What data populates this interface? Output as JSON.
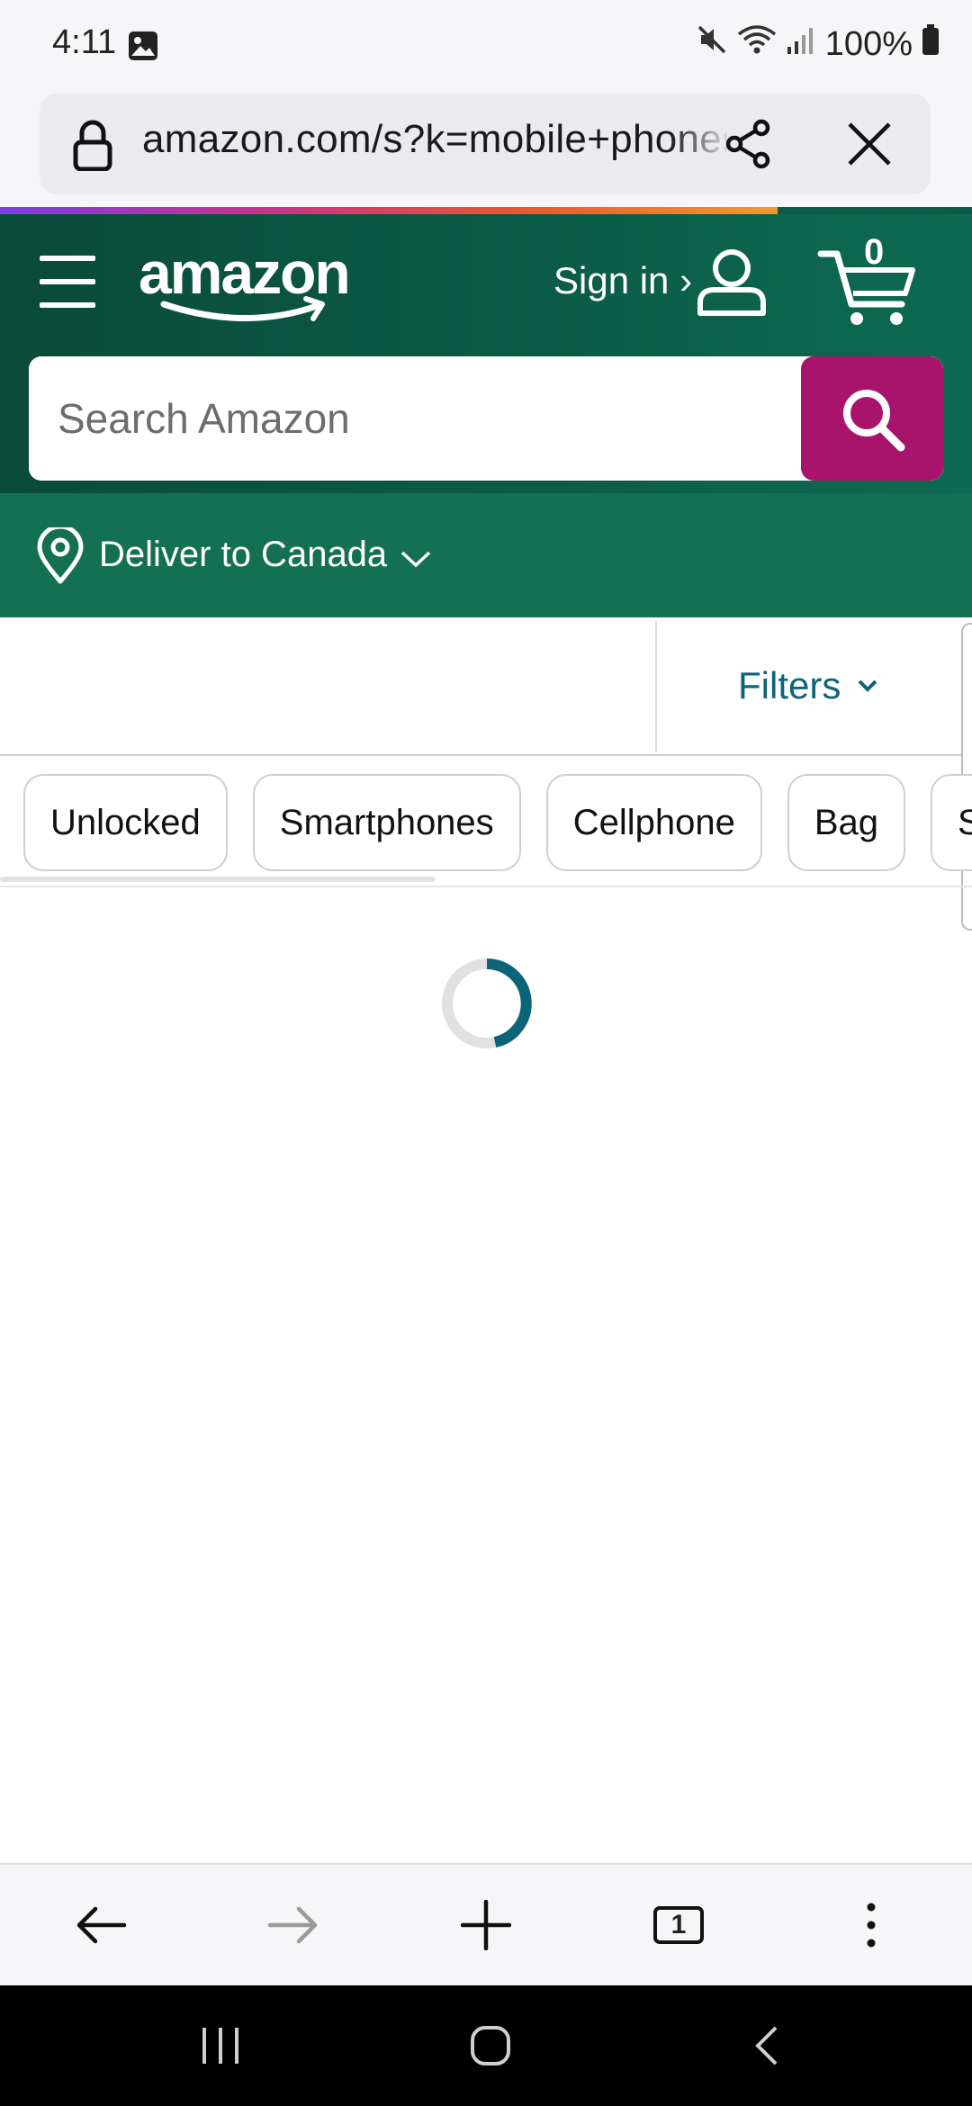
{
  "status_bar": {
    "time": "4:11",
    "battery": "100%",
    "icons": [
      "image-icon",
      "mute-icon",
      "wifi-icon",
      "signal-icon",
      "battery-icon"
    ]
  },
  "browser": {
    "url": "amazon.com/s?k=mobile+phones",
    "load_progress": 0.8,
    "tab_count": "1"
  },
  "amazon": {
    "logo_text": "amazon",
    "sign_in": "Sign in ›",
    "cart_count": "0",
    "search_placeholder": "Search Amazon",
    "deliver_to": "Deliver to Canada",
    "filters_label": "Filters",
    "chips": [
      "Unlocked",
      "Smartphones",
      "Cellphone",
      "Bag",
      "St"
    ]
  },
  "colors": {
    "header_green": "#0c6a50",
    "deliver_green": "#137052",
    "search_button": "#a8146c",
    "filters_teal": "#0d6479",
    "spinner_teal": "#0d6479"
  }
}
